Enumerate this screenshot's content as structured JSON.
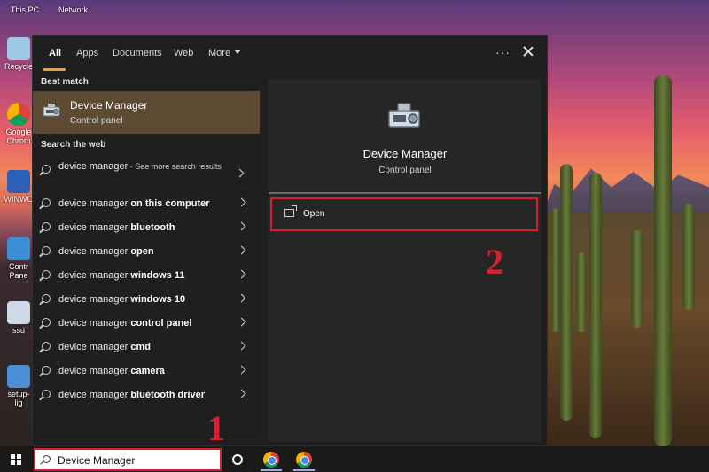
{
  "desktop": {
    "top_labels": [
      "This PC",
      "Network"
    ],
    "icons": [
      {
        "label": "Recycle",
        "color": "#9ec9e6"
      },
      {
        "label": "Google Chrom",
        "color": "#db4437"
      },
      {
        "label": "WINWO",
        "color": "#2b5fb8"
      },
      {
        "label": "Contr Pane",
        "color": "#3b8fd8"
      },
      {
        "label": "ssd",
        "color": "#cfd8e6"
      },
      {
        "label": "setup-lig",
        "color": "#4a8fd8"
      }
    ]
  },
  "start_menu": {
    "tabs": [
      {
        "label": "All",
        "active": true
      },
      {
        "label": "Apps"
      },
      {
        "label": "Documents"
      },
      {
        "label": "Web"
      },
      {
        "label": "More"
      }
    ],
    "more_icon": "ellipsis-icon",
    "close_icon": "close-icon",
    "best_match_heading": "Best match",
    "best_match": {
      "title": "Device Manager",
      "subtitle": "Control panel",
      "icon": "device-manager-icon"
    },
    "search_web_heading": "Search the web",
    "web_results": [
      {
        "plain": "device manager",
        "bold": "",
        "extra": " - See more search results"
      },
      {
        "plain": "device manager ",
        "bold": "on this computer"
      },
      {
        "plain": "device manager ",
        "bold": "bluetooth"
      },
      {
        "plain": "device manager ",
        "bold": "open"
      },
      {
        "plain": "device manager ",
        "bold": "windows 11"
      },
      {
        "plain": "device manager ",
        "bold": "windows 10"
      },
      {
        "plain": "device manager ",
        "bold": "control panel"
      },
      {
        "plain": "device manager ",
        "bold": "cmd"
      },
      {
        "plain": "device manager ",
        "bold": "camera"
      },
      {
        "plain": "device manager ",
        "bold": "bluetooth driver"
      }
    ],
    "preview": {
      "title": "Device Manager",
      "subtitle": "Control panel",
      "open_label": "Open"
    }
  },
  "annotations": {
    "step1": "1",
    "step2": "2",
    "highlight_color": "#d4232e"
  },
  "taskbar": {
    "search_value": "Device Manager",
    "accent": "#8ab4f8"
  }
}
